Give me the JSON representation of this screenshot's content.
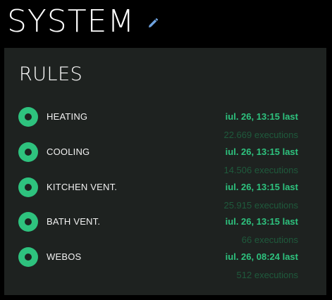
{
  "header": {
    "title": "SYSTEM",
    "edit_icon": "pencil-icon"
  },
  "colors": {
    "accent": "#2ec27e",
    "panel_bg": "#1e2220",
    "muted_green": "#1f5a3c",
    "background": "#000000"
  },
  "rules": {
    "title": "RULES",
    "items": [
      {
        "name": "HEATING",
        "last": "iul. 26, 13:15 last",
        "executions": "22.669 executions",
        "enabled": true
      },
      {
        "name": "COOLING",
        "last": "iul. 26, 13:15 last",
        "executions": "14.506 executions",
        "enabled": true
      },
      {
        "name": "KITCHEN VENT.",
        "last": "iul. 26, 13:15 last",
        "executions": "25.915 executions",
        "enabled": true
      },
      {
        "name": "BATH VENT.",
        "last": "iul. 26, 13:15 last",
        "executions": "66 executions",
        "enabled": true
      },
      {
        "name": "WEBOS",
        "last": "iul. 26, 08:24 last",
        "executions": "512 executions",
        "enabled": true
      }
    ]
  }
}
